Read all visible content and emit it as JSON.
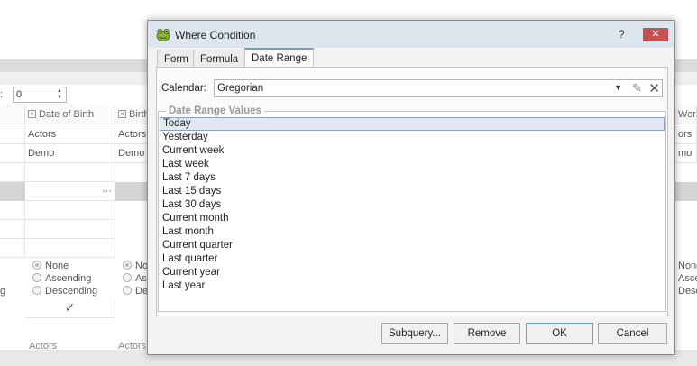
{
  "background": {
    "spin_value": "0",
    "spin_label": ":",
    "headers": [
      "Date of Birth",
      "Birth C",
      "Wort"
    ],
    "row1": [
      "Actors",
      "Actors",
      "ors"
    ],
    "row2": [
      "Demo",
      "Demo",
      "mo"
    ],
    "ellipsis": "···",
    "sort_left": [
      "None",
      "Ascending",
      "Descending"
    ],
    "sort_mid": [
      "No",
      "As",
      "De"
    ],
    "sort_right": [
      "None",
      "Asce",
      "Desc"
    ],
    "sort_frag_left": "g",
    "checkmark": "✓",
    "bottom_row": [
      "Actors",
      "Actors"
    ]
  },
  "dialog": {
    "title": "Where Condition",
    "help": "?",
    "close": "✕",
    "tabs": [
      {
        "label": "Form",
        "active": false
      },
      {
        "label": "Formula",
        "active": false
      },
      {
        "label": "Date Range",
        "active": true
      }
    ],
    "calendar_label": "Calendar:",
    "calendar_value": "Gregorian",
    "group_title": "Date Range Values",
    "date_range_values": [
      "Today",
      "Yesterday",
      "Current week",
      "Last week",
      "Last 7 days",
      "Last 15 days",
      "Last 30 days",
      "Current month",
      "Last month",
      "Current quarter",
      "Last quarter",
      "Current year",
      "Last year"
    ],
    "selected_index": 0,
    "buttons": {
      "subquery": "Subquery...",
      "remove": "Remove",
      "ok": "OK",
      "cancel": "Cancel"
    }
  },
  "colors": {
    "titlebar": "#dde6ee",
    "close": "#c75050",
    "tab_accent": "#6b9dd1",
    "selection": "#dfe9f3"
  }
}
